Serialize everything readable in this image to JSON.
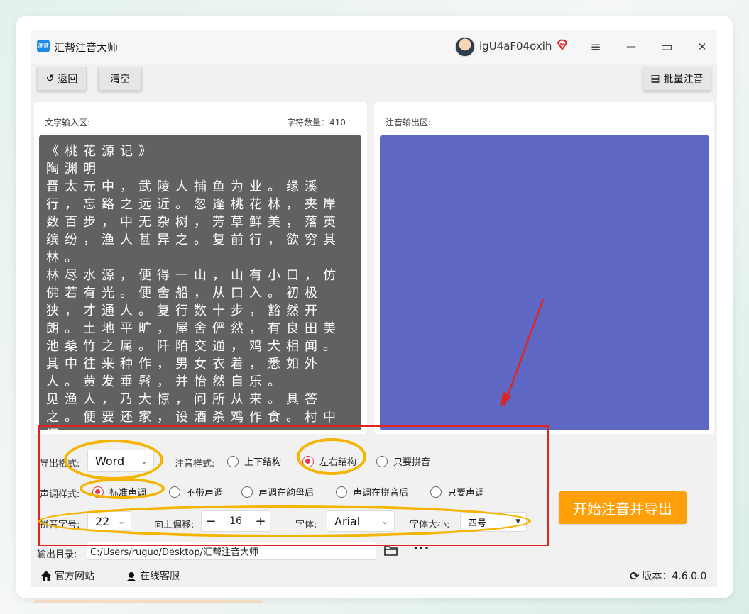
{
  "app": {
    "title": "汇帮注音大师",
    "logo_text": "注音"
  },
  "user": {
    "name": "igU4aF04oxih"
  },
  "window_controls": {
    "menu_icon": "≡",
    "minimize_icon": "—",
    "maximize_icon": "▭",
    "close_icon": "✕"
  },
  "toolbar": {
    "back_label": "返回",
    "back_icon": "↺",
    "clear_label": "清空",
    "batch_label": "批量注音",
    "batch_icon": "▤"
  },
  "input_panel": {
    "label": "文字输入区:",
    "char_count_label": "字符数量：410",
    "text": "《桃花源记》\n陶渊明\n晋太元中，武陵人捕鱼为业。缘溪行，忘路之远近。忽逢桃花林，夹岸数百步，中无杂树，芳草鲜美，落英缤纷，渔人甚异之。复前行，欲穷其林。\n林尽水源，便得一山，山有小口，仿佛若有光。便舍船，从口入。初极狭，才通人。复行数十步，豁然开朗。土地平旷，屋舍俨然，有良田美池桑竹之属。阡陌交通，鸡犬相闻。其中往来种作，男女衣着，悉如外人。黄发垂髫，并怡然自乐。\n见渔人，乃大惊，问所从来。具答之。便要还家，设酒杀鸡作食。村中闻"
  },
  "output_panel": {
    "label": "注音输出区:"
  },
  "settings": {
    "export_format": {
      "label": "导出格式:",
      "value": "Word"
    },
    "annotation_style": {
      "label": "注音样式:",
      "options": [
        "上下结构",
        "左右结构",
        "只要拼音"
      ],
      "selected": "左右结构"
    },
    "tone_style": {
      "label": "声调样式:",
      "options": [
        "标准声调",
        "不带声调",
        "声调在韵母后",
        "声调在拼音后",
        "只要声调"
      ],
      "selected": "标准声调"
    },
    "pinyin_size": {
      "label": "拼音字号:",
      "value": "22"
    },
    "offset": {
      "label": "向上偏移:",
      "value": "16",
      "minus": "−",
      "plus": "+"
    },
    "font": {
      "label": "字体:",
      "value": "Arial"
    },
    "font_size": {
      "label": "字体大小:",
      "value": "四号"
    },
    "output_dir": {
      "label": "输出目录:",
      "value": "C:/Users/ruguo/Desktop/汇帮注音大师"
    }
  },
  "start_button": {
    "label": "开始注音并导出"
  },
  "footer": {
    "website": "官方网站",
    "support": "在线客服",
    "version": "版本：4.6.0.0"
  },
  "colors": {
    "accent_orange": "#ff9f0a",
    "radio_red": "#e8334a",
    "output_blue": "#5e68c4",
    "input_gray": "#616164",
    "annotation_red": "#e0241f",
    "annotation_yellow": "#f4b400"
  }
}
